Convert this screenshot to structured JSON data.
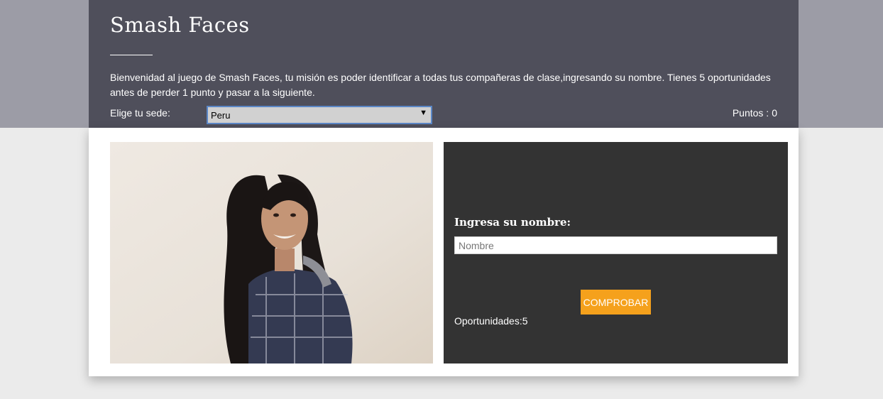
{
  "header": {
    "title": "Smash Faces",
    "intro": "Bienvenidad al juego de Smash Faces, tu misión es poder identificar a todas tus compañeras de clase,ingresando su nombre. Tienes 5 oportunidades antes de perder 1 punto y pasar a la siguiente.",
    "sede_label": "Elige tu sede:",
    "sede_selected": "Peru",
    "points_label": "Puntos :",
    "points_value": "0"
  },
  "photo": {
    "icon": "student-portrait"
  },
  "form": {
    "name_label": "Ingresa su nombre:",
    "name_placeholder": "Nombre",
    "name_value": "",
    "submit_label": "COMPROBAR",
    "chances_label": "Oportunidades:",
    "chances_value": "5"
  },
  "colors": {
    "top_band": "#9c9ca6",
    "header_bg": "#4f4f5b",
    "page_bg": "#ebebeb",
    "panel_bg": "#333333",
    "button_bg": "#f5a11c"
  }
}
